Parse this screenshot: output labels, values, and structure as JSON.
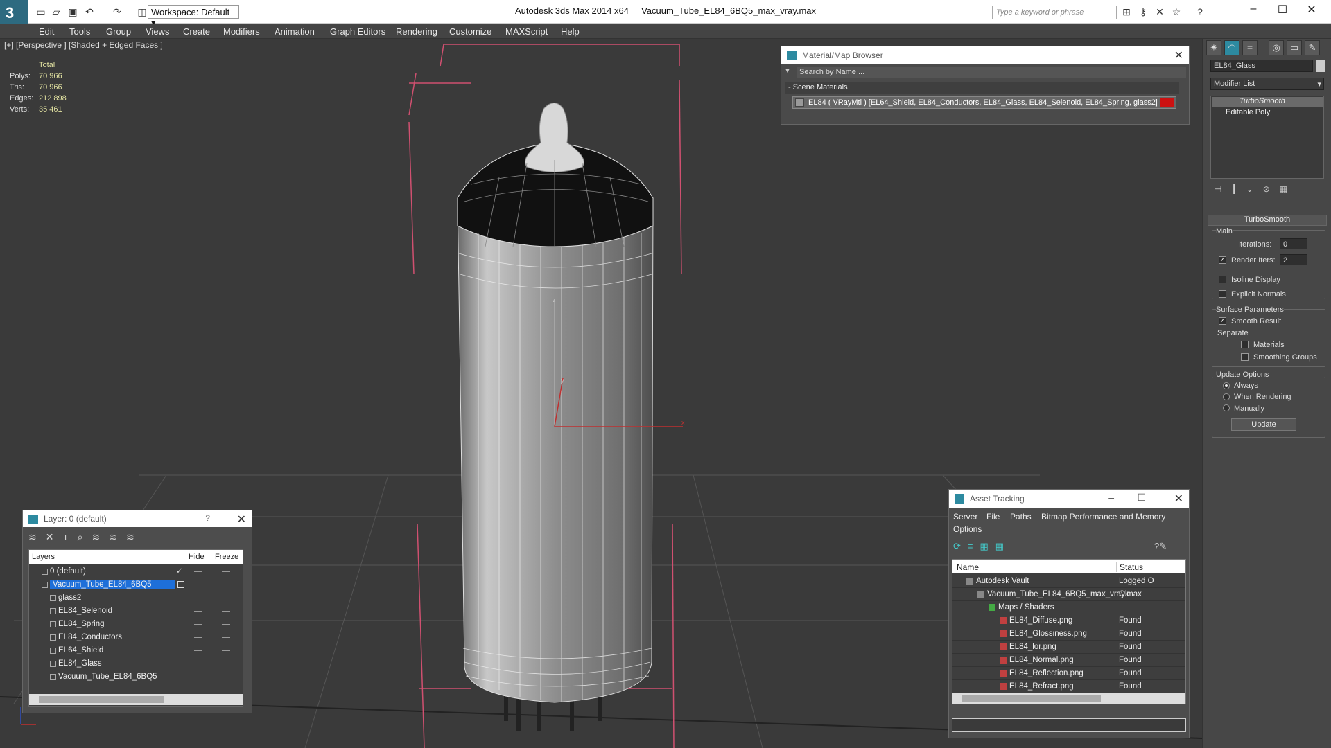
{
  "app": {
    "title_app": "Autodesk 3ds Max  2014 x64",
    "title_file": "Vacuum_Tube_EL84_6BQ5_max_vray.max",
    "workspace": "Workspace: Default",
    "search_placeholder": "Type a keyword or phrase"
  },
  "menu": [
    "Edit",
    "Tools",
    "Group",
    "Views",
    "Create",
    "Modifiers",
    "Animation",
    "Graph Editors",
    "Rendering",
    "Customize",
    "MAXScript",
    "Help"
  ],
  "viewport": {
    "label": "[+] [Perspective ] [Shaded + Edged Faces ]",
    "stats_header": "Total",
    "stats": [
      {
        "k": "Polys:",
        "v": "70 966"
      },
      {
        "k": "Tris:",
        "v": "70 966"
      },
      {
        "k": "Edges:",
        "v": "212 898"
      },
      {
        "k": "Verts:",
        "v": "35 461"
      }
    ],
    "axis_z": "z",
    "axis_y": "y",
    "axis_x": "x"
  },
  "material_browser": {
    "title": "Material/Map Browser",
    "search": "Search by Name ...",
    "section": "- Scene Materials",
    "item": "EL84  ( VRayMtl ) [EL64_Shield, EL84_Conductors, EL84_Glass, EL84_Selenoid, EL84_Spring, glass2]"
  },
  "command_panel": {
    "object_name": "EL84_Glass",
    "modifier_list": "Modifier List",
    "stack": [
      "TurboSmooth",
      "Editable Poly"
    ],
    "rollout_title": "TurboSmooth",
    "main_label": "Main",
    "iterations_label": "Iterations:",
    "iterations_value": "0",
    "render_iters_label": "Render Iters:",
    "render_iters_value": "2",
    "isoline": "Isoline Display",
    "explicit": "Explicit Normals",
    "surface_params": "Surface Parameters",
    "smooth_result": "Smooth Result",
    "separate": "Separate",
    "materials": "Materials",
    "smoothing_groups": "Smoothing Groups",
    "update_options": "Update Options",
    "always": "Always",
    "when_rendering": "When Rendering",
    "manually": "Manually",
    "update_button": "Update"
  },
  "layer_panel": {
    "title": "Layer: 0 (default)",
    "help": "?",
    "col_layers": "Layers",
    "col_hide": "Hide",
    "col_freeze": "Freeze",
    "rows": [
      {
        "name": "0 (default)",
        "indent": 0,
        "selected": false
      },
      {
        "name": "Vacuum_Tube_EL84_6BQ5",
        "indent": 0,
        "selected": true
      },
      {
        "name": "glass2",
        "indent": 1,
        "selected": false
      },
      {
        "name": "EL84_Selenoid",
        "indent": 1,
        "selected": false
      },
      {
        "name": "EL84_Spring",
        "indent": 1,
        "selected": false
      },
      {
        "name": "EL84_Conductors",
        "indent": 1,
        "selected": false
      },
      {
        "name": "EL64_Shield",
        "indent": 1,
        "selected": false
      },
      {
        "name": "EL84_Glass",
        "indent": 1,
        "selected": false
      },
      {
        "name": "Vacuum_Tube_EL84_6BQ5",
        "indent": 1,
        "selected": false
      }
    ]
  },
  "asset_tracking": {
    "title": "Asset Tracking",
    "menu": [
      "Server",
      "File",
      "Paths",
      "Bitmap Performance and Memory",
      "Options"
    ],
    "col_name": "Name",
    "col_status": "Status",
    "rows": [
      {
        "name": "Autodesk Vault",
        "status": "Logged O",
        "indent": 0
      },
      {
        "name": "Vacuum_Tube_EL84_6BQ5_max_vray.max",
        "status": "Ok",
        "indent": 1
      },
      {
        "name": "Maps / Shaders",
        "status": "",
        "indent": 2
      },
      {
        "name": "EL84_Diffuse.png",
        "status": "Found",
        "indent": 3
      },
      {
        "name": "EL84_Glossiness.png",
        "status": "Found",
        "indent": 3
      },
      {
        "name": "EL84_lor.png",
        "status": "Found",
        "indent": 3
      },
      {
        "name": "EL84_Normal.png",
        "status": "Found",
        "indent": 3
      },
      {
        "name": "EL84_Reflection.png",
        "status": "Found",
        "indent": 3
      },
      {
        "name": "EL84_Refract.png",
        "status": "Found",
        "indent": 3
      }
    ]
  },
  "colors": {
    "accent": "#2d8aa0",
    "selection": "#1e6fd9",
    "material_swatch": "#cc1111",
    "bbox": "#d05070"
  }
}
